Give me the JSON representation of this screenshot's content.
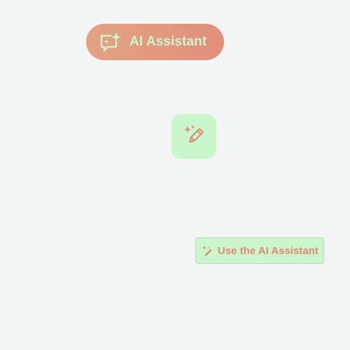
{
  "buttons": {
    "pill": {
      "label": "AI Assistant",
      "icon": "chat-sparkle-icon"
    },
    "square": {
      "icon": "magic-pencil-icon"
    },
    "rect": {
      "label": "Use the AI Assistant",
      "icon": "magic-wand-icon"
    }
  },
  "colors": {
    "background": "#f3f4f4",
    "pill_background": "#e1977e",
    "pill_text": "#ccf5cf",
    "green_background": "#c9f6cb",
    "accent_text": "#e0887a"
  }
}
